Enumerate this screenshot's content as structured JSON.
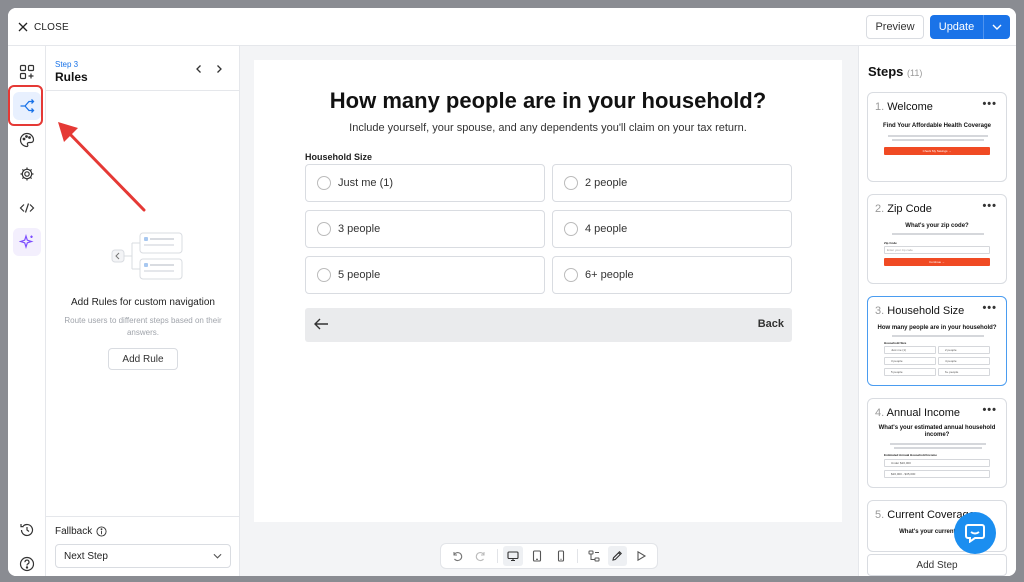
{
  "topbar": {
    "close_label": "CLOSE",
    "preview_label": "Preview",
    "update_label": "Update"
  },
  "colors": {
    "accent": "#1a73e8",
    "highlight": "#e53935",
    "cta": "#f04a23",
    "chat": "#1b8ef0"
  },
  "rail": {
    "icons": [
      "layout-add-icon",
      "branch-icon",
      "palette-icon",
      "gear-icon",
      "code-icon",
      "sparkle-icon",
      "history-icon",
      "help-icon"
    ]
  },
  "rules_panel": {
    "step_number": "Step 3",
    "title": "Rules",
    "empty_title": "Add Rules for custom navigation",
    "empty_desc": "Route users to different steps based on their answers.",
    "add_rule_label": "Add Rule",
    "fallback_label": "Fallback",
    "fallback_value": "Next Step"
  },
  "question": {
    "title": "How many people are in your household?",
    "subtitle": "Include yourself, your spouse, and any dependents you'll claim on your tax return.",
    "field_label": "Household Size",
    "options": [
      "Just me (1)",
      "2 people",
      "3 people",
      "4 people",
      "5 people",
      "6+ people"
    ],
    "back_label": "Back"
  },
  "steps": {
    "title": "Steps",
    "count": "(11)",
    "add_step_label": "Add Step",
    "items": [
      {
        "num": "1.",
        "name": "Welcome",
        "thumb_title": "Find Your Affordable Health Coverage",
        "thumb_cta": "Check My Savings →"
      },
      {
        "num": "2.",
        "name": "Zip Code",
        "thumb_title": "What's your zip code?",
        "thumb_field": "Zip Code",
        "thumb_placeholder": "Enter your zip code",
        "thumb_cta": "Continue →"
      },
      {
        "num": "3.",
        "name": "Household Size",
        "thumb_title": "How many people are in your household?",
        "thumb_field": "Household Size",
        "thumb_options": [
          "Just me (1)",
          "2 people",
          "3 people",
          "4 people",
          "5 people",
          "6+ people"
        ]
      },
      {
        "num": "4.",
        "name": "Annual Income",
        "thumb_title": "What's your estimated annual household income?",
        "thumb_field": "Estimated Annual Household Income",
        "thumb_options": [
          "Under $20,000",
          "$20,000 - $35,000"
        ]
      },
      {
        "num": "5.",
        "name": "Current Coverage",
        "thumb_title": "What's your current health"
      }
    ]
  }
}
